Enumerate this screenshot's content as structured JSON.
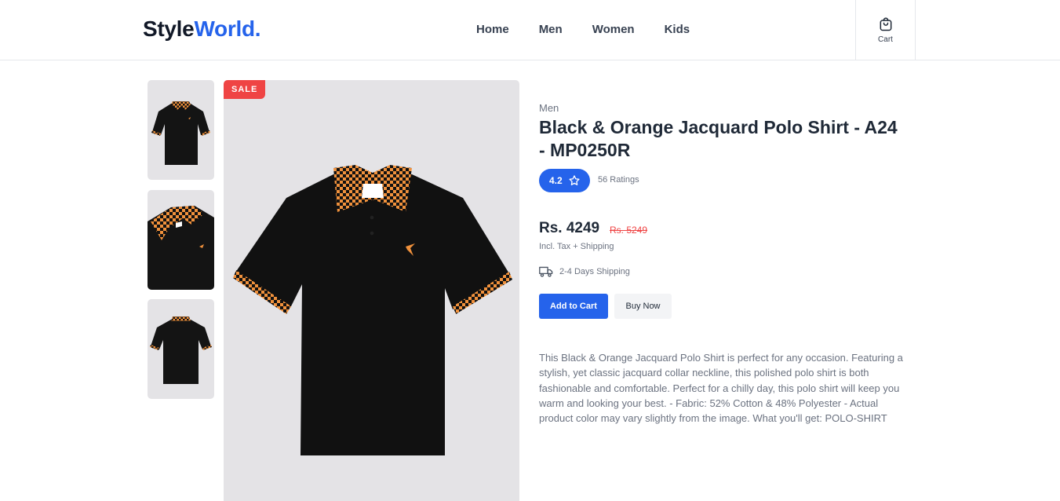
{
  "header": {
    "logo_main": "Style",
    "logo_accent": "World.",
    "nav": [
      "Home",
      "Men",
      "Women",
      "Kids"
    ],
    "cart_label": "Cart",
    "cart_icon": "shopping-bag-icon"
  },
  "gallery": {
    "sale_badge": "SALE",
    "thumbnails": [
      "front-view",
      "collar-detail",
      "back-view"
    ]
  },
  "product": {
    "category": "Men",
    "title": "Black & Orange Jacquard Polo Shirt - A24 - MP0250R",
    "rating": "4.2",
    "rating_icon": "star-icon",
    "ratings_count": "56 Ratings",
    "price": "Rs. 4249",
    "old_price": "Rs. 5249",
    "tax_note": "Incl. Tax + Shipping",
    "shipping_icon": "truck-icon",
    "shipping": "2-4 Days Shipping",
    "add_to_cart": "Add to Cart",
    "buy_now": "Buy Now",
    "description": "This Black & Orange Jacquard Polo Shirt is perfect for any occasion. Featuring a stylish, yet classic jacquard collar neckline, this polished polo shirt is both fashionable and comfortable. Perfect for a chilly day, this polo shirt will keep you warm and looking your best. - Fabric: 52% Cotton & 48% Polyester - Actual product color may vary slightly from the image. What you'll get: POLO-SHIRT"
  },
  "colors": {
    "accent": "#2563eb",
    "sale": "#ef4444",
    "image_bg": "#e4e3e6",
    "shirt": "#111111",
    "check": "#f0913c"
  }
}
